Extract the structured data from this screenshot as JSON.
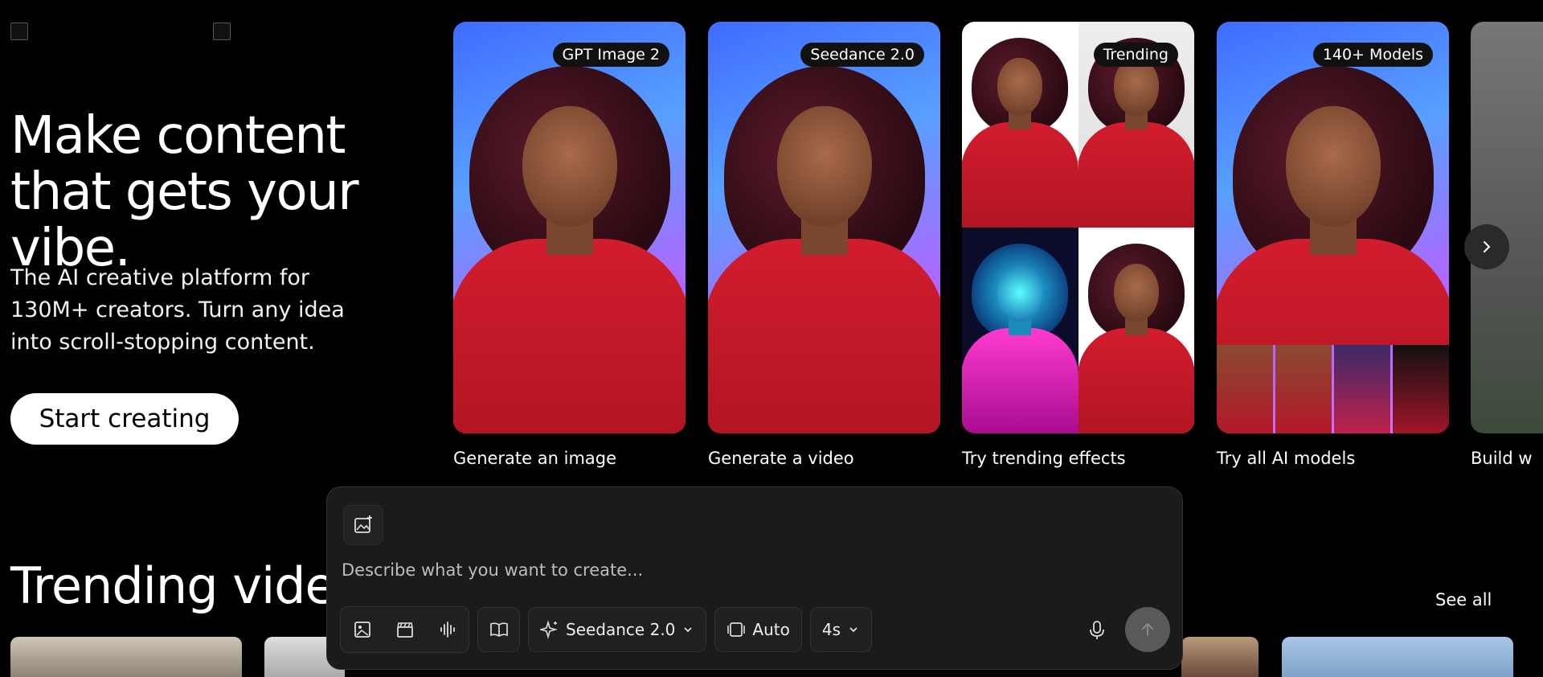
{
  "hero": {
    "title": "Make content that gets your vibe.",
    "subtitle": "The AI creative platform for 130M+ creators. Turn any idea into scroll-stopping content.",
    "cta": "Start creating"
  },
  "cards": [
    {
      "badge": "GPT Image 2",
      "caption": "Generate an image"
    },
    {
      "badge": "Seedance 2.0",
      "caption": "Generate a video"
    },
    {
      "badge": "Trending",
      "caption": "Try trending effects"
    },
    {
      "badge": "140+ Models",
      "caption": "Try all AI models"
    },
    {
      "caption": "Build w"
    }
  ],
  "trending": {
    "title": "Trending video",
    "see_all": "See all"
  },
  "composer": {
    "placeholder": "Describe what you want to create...",
    "model": "Seedance 2.0",
    "aspect": "Auto",
    "duration": "4s"
  },
  "colors": {
    "background": "#000000",
    "shirt": "#c8182a",
    "composer_bg": "#1b1b1b"
  }
}
